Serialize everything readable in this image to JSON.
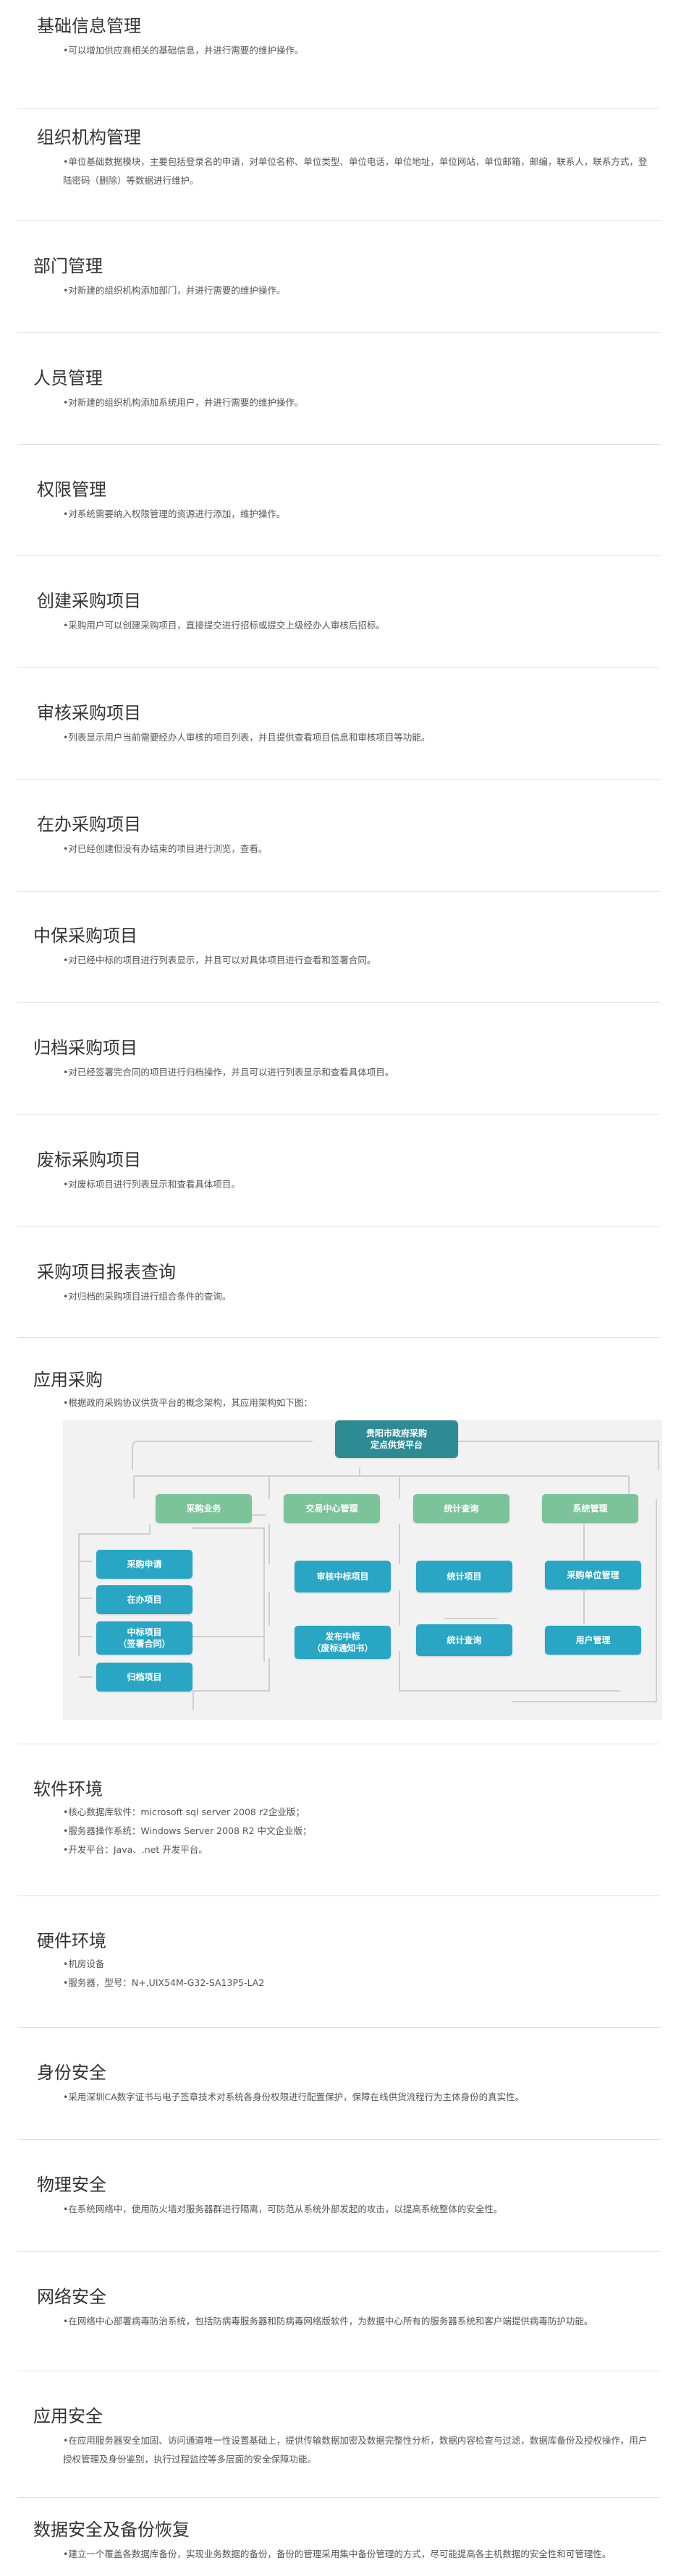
{
  "sections": [
    {
      "title": "基础信息管理",
      "lines": [
        "•可以增加供应商相关的基础信息，并进行需要的维护操作。"
      ]
    },
    {
      "title": "组织机构管理",
      "lines": [
        "•单位基础数据模块，主要包括登录名的申请，对单位名称、单位类型、单位电话，单位地址，单位网站，单位邮箱，邮编，联系人，联系方式，登陆密码（删除）等数据进行维护。"
      ]
    },
    {
      "title": "部门管理",
      "lines": [
        "•对新建的组织机构添加部门，并进行需要的维护操作。"
      ]
    },
    {
      "title": "人员管理",
      "lines": [
        "•对新建的组织机构添加系统用户，并进行需要的维护操作。"
      ]
    },
    {
      "title": "权限管理",
      "lines": [
        "•对系统需要纳入权限管理的资源进行添加，维护操作。"
      ]
    },
    {
      "title": "创建采购项目",
      "lines": [
        "•采购用户可以创建采购项目，直接提交进行招标或提交上级经办人审核后招标。"
      ]
    },
    {
      "title": "审核采购项目",
      "lines": [
        "•列表显示用户当前需要经办人审核的项目列表，并且提供查看项目信息和审核项目等功能。"
      ]
    },
    {
      "title": "在办采购项目",
      "lines": [
        "•对已经创建但没有办结束的项目进行浏览，查看。"
      ]
    },
    {
      "title": "中保采购项目",
      "lines": [
        "•对已经中标的项目进行列表显示，并且可以对具体项目进行查看和签署合同。"
      ]
    },
    {
      "title": "归档采购项目",
      "lines": [
        "•对已经签署完合同的项目进行归档操作，并且可以进行列表显示和查看具体项目。"
      ]
    },
    {
      "title": "废标采购项目",
      "lines": [
        "•对废标项目进行列表显示和查看具体项目。"
      ]
    },
    {
      "title": "采购项目报表查询",
      "lines": [
        "•对归档的采购项目进行组合条件的查询。"
      ]
    }
  ],
  "app_section": {
    "title": "应用采购",
    "lines": [
      "•根据政府采购协议供货平台的概念架构，其应用架构如下图："
    ],
    "diagram": {
      "top": "贵阳市政府采购\n定点供货平台",
      "level1": [
        "采购业务",
        "交易中心管理",
        "统计查询",
        "系统管理"
      ],
      "level2": [
        "采购申请",
        "在办项目",
        "中标项目\n（签署合同）",
        "归档项目",
        "审核中标项目",
        "发布中标\n（废标通知书）",
        "统计项目",
        "统计查询",
        "采购单位管理",
        "用户管理"
      ]
    }
  },
  "tail_sections": [
    {
      "title": "软件环境",
      "lines": [
        "•核心数据库软件：microsoft  sql server 2008 r2企业版；",
        "•服务器操作系统：Windows Server 2008 R2 中文企业版；",
        "•开发平台：Java、.net 开发平台。"
      ]
    },
    {
      "title": "硬件环境",
      "lines": [
        "•机房设备",
        "•服务器，型号：N+,UIX54M-G32-SA13P5-LA2"
      ]
    },
    {
      "title": "身份安全",
      "lines": [
        "•采用深圳CA数字证书与电子签章技术对系统各身份权限进行配置保护，保障在线供货流程行为主体身份的真实性。"
      ]
    },
    {
      "title": "物理安全",
      "lines": [
        "•在系统网络中，使用防火墙对服务器群进行隔离，可防范从系统外部发起的攻击，以提高系统整体的安全性。"
      ]
    },
    {
      "title": "网络安全",
      "lines": [
        "•在网络中心部署病毒防治系统，包括防病毒服务器和防病毒网络版软件，为数据中心所有的服务器系统和客户端提供病毒防护功能。"
      ]
    },
    {
      "title": "应用安全",
      "lines": [
        "•在应用服务器安全加固、访问通道唯一性设置基础上，提供传输数据加密及数据完整性分析，数据内容检查与过滤，数据库备份及授权操作，用户授权管理及身份鉴别，执行过程监控等多层面的安全保障功能。"
      ]
    },
    {
      "title": "数据安全及备份恢复",
      "lines": [
        "•建立一个覆盖各数据库备份，实现业务数据的备份，备份的管理采用集中备份管理的方式，尽可能提高各主机数据的安全性和可管理性。"
      ]
    }
  ],
  "colors": {
    "top_node": "#2e8b94",
    "green_node": "#7cc39a",
    "blue_node": "#29a6c4",
    "divider": "#e2e2e2"
  }
}
